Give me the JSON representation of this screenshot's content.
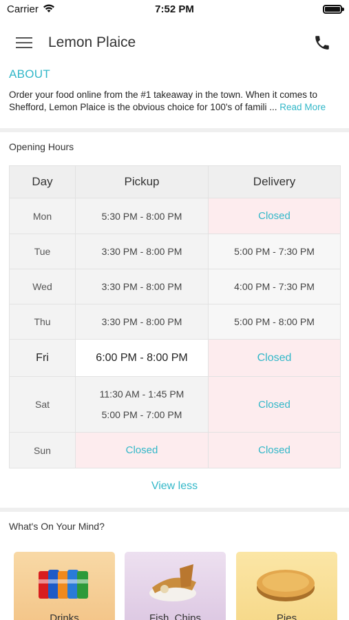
{
  "status": {
    "carrier": "Carrier",
    "time": "7:52 PM"
  },
  "header": {
    "title": "Lemon Plaice",
    "menu_icon": "hamburger-menu-icon",
    "phone_icon": "phone-icon"
  },
  "about": {
    "title": "ABOUT",
    "text_line1": "Order your food online from the #1 takeaway in the town. When it comes to",
    "text_line2": "Shefford, Lemon Plaice is the obvious choice for 100's of famili ... ",
    "read_more": "Read More"
  },
  "opening_hours": {
    "title": "Opening Hours",
    "columns": [
      "Day",
      "Pickup",
      "Delivery"
    ],
    "rows": [
      {
        "day": "Mon",
        "pickup": [
          "5:30 PM - 8:00 PM"
        ],
        "delivery": "Closed"
      },
      {
        "day": "Tue",
        "pickup": [
          "3:30 PM - 8:00 PM"
        ],
        "delivery": "5:00 PM - 7:30 PM"
      },
      {
        "day": "Wed",
        "pickup": [
          "3:30 PM - 8:00 PM"
        ],
        "delivery": "4:00 PM - 7:30 PM"
      },
      {
        "day": "Thu",
        "pickup": [
          "3:30 PM - 8:00 PM"
        ],
        "delivery": "5:00 PM - 8:00 PM"
      },
      {
        "day": "Fri",
        "pickup": [
          "6:00 PM - 8:00 PM"
        ],
        "delivery": "Closed"
      },
      {
        "day": "Sat",
        "pickup": [
          "11:30 AM - 1:45 PM",
          "5:00 PM - 7:00 PM"
        ],
        "delivery": "Closed"
      },
      {
        "day": "Sun",
        "pickup": "Closed",
        "delivery": "Closed"
      }
    ],
    "view_less": "View less"
  },
  "mind": {
    "title": "What's On Your Mind?",
    "categories": [
      {
        "label": "Drinks"
      },
      {
        "label": "Fish, Chips"
      },
      {
        "label": "Pies"
      }
    ]
  },
  "colors": {
    "accent": "#31b7c8",
    "closed_bg": "#fdecee"
  }
}
